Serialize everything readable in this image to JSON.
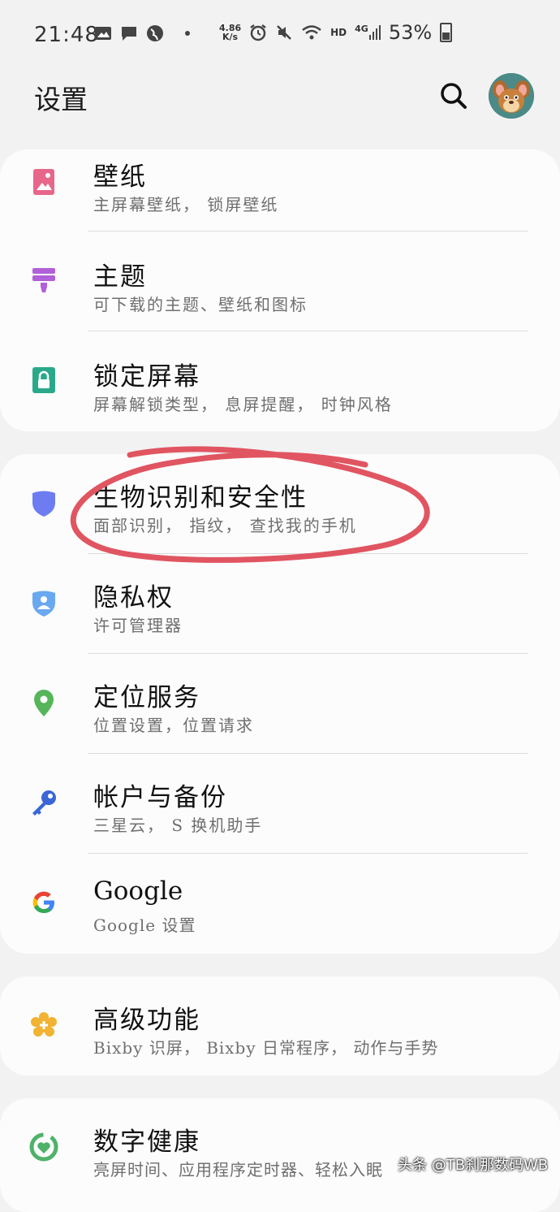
{
  "status_bar": {
    "time": "21:48",
    "net_speed_value": "4.86",
    "net_speed_unit": "K/s",
    "hd_label": "HD",
    "network_label": "4G",
    "battery_percent": "53%",
    "icons": [
      "image-icon",
      "message-icon",
      "globe-icon",
      "alarm-icon",
      "mute-icon",
      "wifi-icon",
      "signal-icon",
      "battery-icon"
    ]
  },
  "header": {
    "title": "设置"
  },
  "groups": [
    {
      "items": [
        {
          "title": "壁纸",
          "subtitle": "主屏幕壁纸， 锁屏壁纸",
          "icon": "wallpaper-icon",
          "color": "#e8668a"
        },
        {
          "title": "主题",
          "subtitle": "可下载的主题、壁纸和图标",
          "icon": "theme-brush-icon",
          "color": "#b060d8"
        },
        {
          "title": "锁定屏幕",
          "subtitle": "屏幕解锁类型， 息屏提醒， 时钟风格",
          "icon": "lock-screen-icon",
          "color": "#2aa98a"
        }
      ]
    },
    {
      "items": [
        {
          "title": "生物识别和安全性",
          "subtitle": "面部识别， 指纹， 查找我的手机",
          "icon": "shield-icon",
          "color": "#6d7cf0"
        },
        {
          "title": "隐私权",
          "subtitle": "许可管理器",
          "icon": "privacy-shield-icon",
          "color": "#6aa8f0"
        },
        {
          "title": "定位服务",
          "subtitle": "位置设置，位置请求",
          "icon": "location-pin-icon",
          "color": "#56b55a"
        },
        {
          "title": "帐户与备份",
          "subtitle": "三星云， S 换机助手",
          "icon": "key-icon",
          "color": "#3a66d6"
        },
        {
          "title": "Google",
          "subtitle": "Google 设置",
          "icon": "google-icon",
          "color": "#4285f4"
        }
      ]
    },
    {
      "items": [
        {
          "title": "高级功能",
          "subtitle": "Bixby 识屏， Bixby 日常程序， 动作与手势",
          "icon": "advanced-gear-icon",
          "color": "#f2b233"
        }
      ]
    },
    {
      "items": [
        {
          "title": "数字健康",
          "subtitle": "亮屏时间、应用程序定时器、轻松入眠",
          "icon": "digital-wellbeing-icon",
          "color": "#4fb26a"
        }
      ]
    }
  ],
  "annotation_color": "#e05561",
  "watermark": "头条 @TB刹那数码WB"
}
